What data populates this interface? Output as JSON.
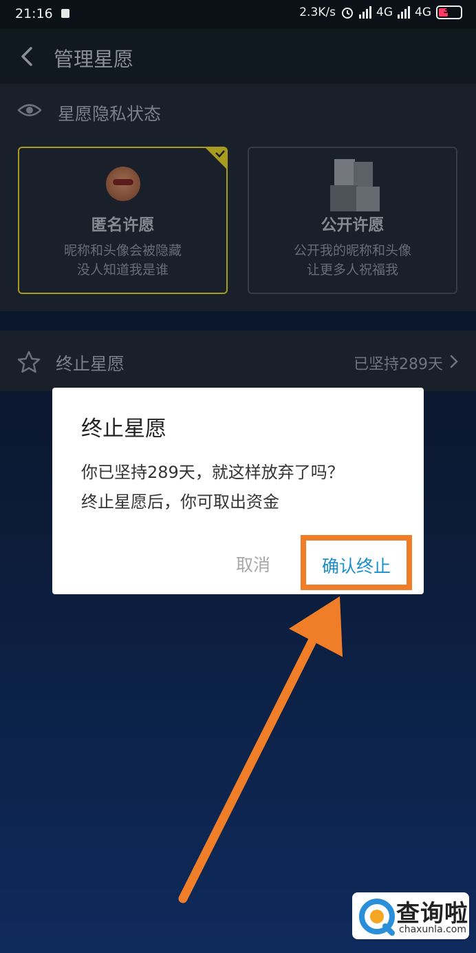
{
  "status_bar": {
    "time": "21:16",
    "net_speed": "2.3K/s",
    "network1": "4G",
    "network2": "4G",
    "battery": "33"
  },
  "navbar": {
    "title": "管理星愿",
    "back_icon": "chevron-left-icon"
  },
  "privacy": {
    "title": "星愿隐私状态",
    "icon": "eye-icon",
    "options": [
      {
        "title": "匿名许愿",
        "desc1": "昵称和头像会被隐藏",
        "desc2": "没人知道我是谁",
        "selected": true
      },
      {
        "title": "公开许愿",
        "desc1": "公开我的昵称和头像",
        "desc2": "让更多人祝福我",
        "selected": false
      }
    ]
  },
  "end_wish": {
    "label": "终止星愿",
    "status": "已坚持289天",
    "icon": "star-icon"
  },
  "dialog": {
    "title": "终止星愿",
    "message1": "你已坚持289天，就这样放弃了吗？",
    "message2": "终止星愿后，你可取出资金",
    "cancel": "取消",
    "confirm": "确认终止",
    "highlight_color": "#f07e28"
  },
  "watermark": {
    "cn": "查询啦",
    "en": "chaxunla.com"
  }
}
